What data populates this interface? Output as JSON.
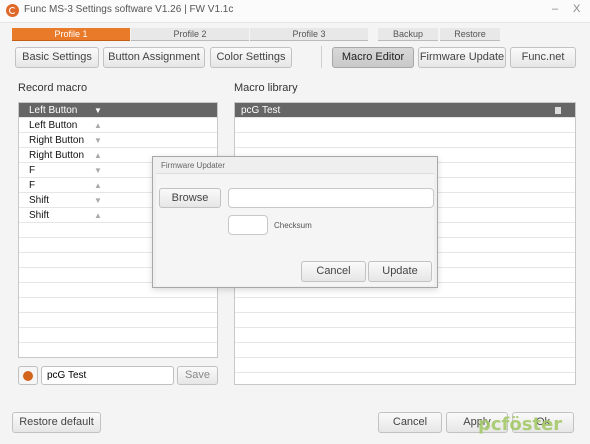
{
  "window": {
    "title": "Func MS-3 Settings software V1.26 | FW V1.1c",
    "minimize": "–",
    "close": "X"
  },
  "profiles": {
    "tabs": [
      "Profile 1",
      "Profile 2",
      "Profile 3"
    ],
    "active": 0,
    "backup": "Backup",
    "restore": "Restore"
  },
  "nav": {
    "basic": "Basic Settings",
    "button_assignment": "Button Assignment",
    "color": "Color Settings",
    "macro_editor": "Macro Editor",
    "firmware_update": "Firmware Update",
    "func_net": "Func.net",
    "active": "macro_editor"
  },
  "record_macro": {
    "label": "Record macro",
    "rows": [
      {
        "key": "Left Button",
        "dir": "down"
      },
      {
        "key": "Left Button",
        "dir": "up"
      },
      {
        "key": "Right Button",
        "dir": "down"
      },
      {
        "key": "Right Button",
        "dir": "up"
      },
      {
        "key": "F",
        "dir": "down"
      },
      {
        "key": "F",
        "dir": "up"
      },
      {
        "key": "Shift",
        "dir": "down"
      },
      {
        "key": "Shift",
        "dir": "up"
      }
    ],
    "macro_name": "pcG Test",
    "save": "Save"
  },
  "macro_library": {
    "label": "Macro library",
    "items": [
      "pcG Test"
    ]
  },
  "dialog": {
    "title": "Firmware Updater",
    "browse": "Browse",
    "path_value": "",
    "checksum_value": "",
    "checksum_label": "Checksum",
    "cancel": "Cancel",
    "update": "Update"
  },
  "footer": {
    "restore_default": "Restore default",
    "cancel": "Cancel",
    "apply": "Apply",
    "ok": "Ok"
  },
  "watermark": "pcföster",
  "colors": {
    "accent": "#e87a2a",
    "selected_row": "#666666"
  }
}
